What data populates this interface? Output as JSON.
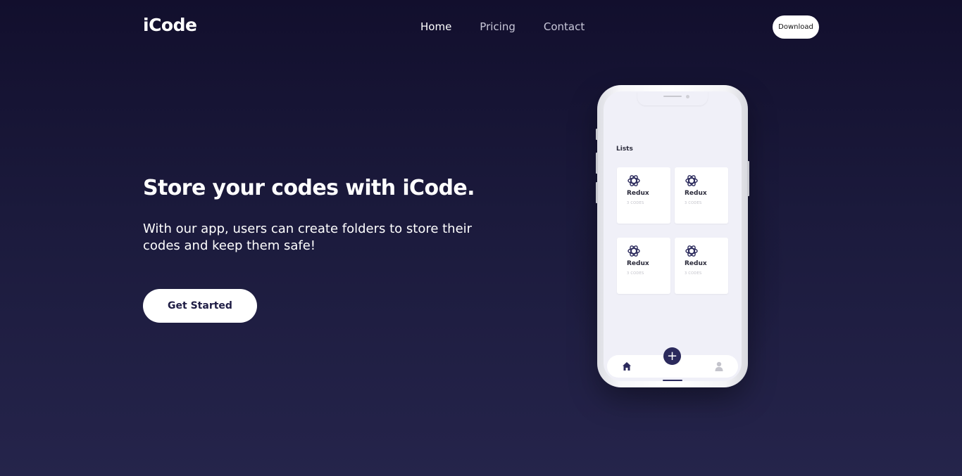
{
  "brand": {
    "name": "iCode"
  },
  "nav": {
    "links": [
      {
        "label": "Home",
        "active": true
      },
      {
        "label": "Pricing",
        "active": false
      },
      {
        "label": "Contact",
        "active": false
      }
    ],
    "download_label": "Download"
  },
  "hero": {
    "title": "Store your codes with iCode.",
    "subtitle": "With our app, users can create folders to store their codes and keep them safe!",
    "cta_label": "Get Started"
  },
  "phone": {
    "lists_title": "Lists",
    "cards": [
      {
        "title": "Redux",
        "meta": "3 CODES",
        "icon": "redux-icon"
      },
      {
        "title": "Redux",
        "meta": "3 CODES",
        "icon": "redux-icon"
      },
      {
        "title": "Redux",
        "meta": "3 CODES",
        "icon": "redux-icon"
      },
      {
        "title": "Redux",
        "meta": "3 CODES",
        "icon": "redux-icon"
      }
    ],
    "fab_label": "+",
    "tabs": [
      "home-icon",
      "user-icon"
    ]
  },
  "colors": {
    "bg_top": "#120f2d",
    "bg_bottom": "#25244b",
    "accent": "#2b2a5c",
    "card_bg": "#ffffff",
    "screen_bg": "#f0f0f8"
  }
}
